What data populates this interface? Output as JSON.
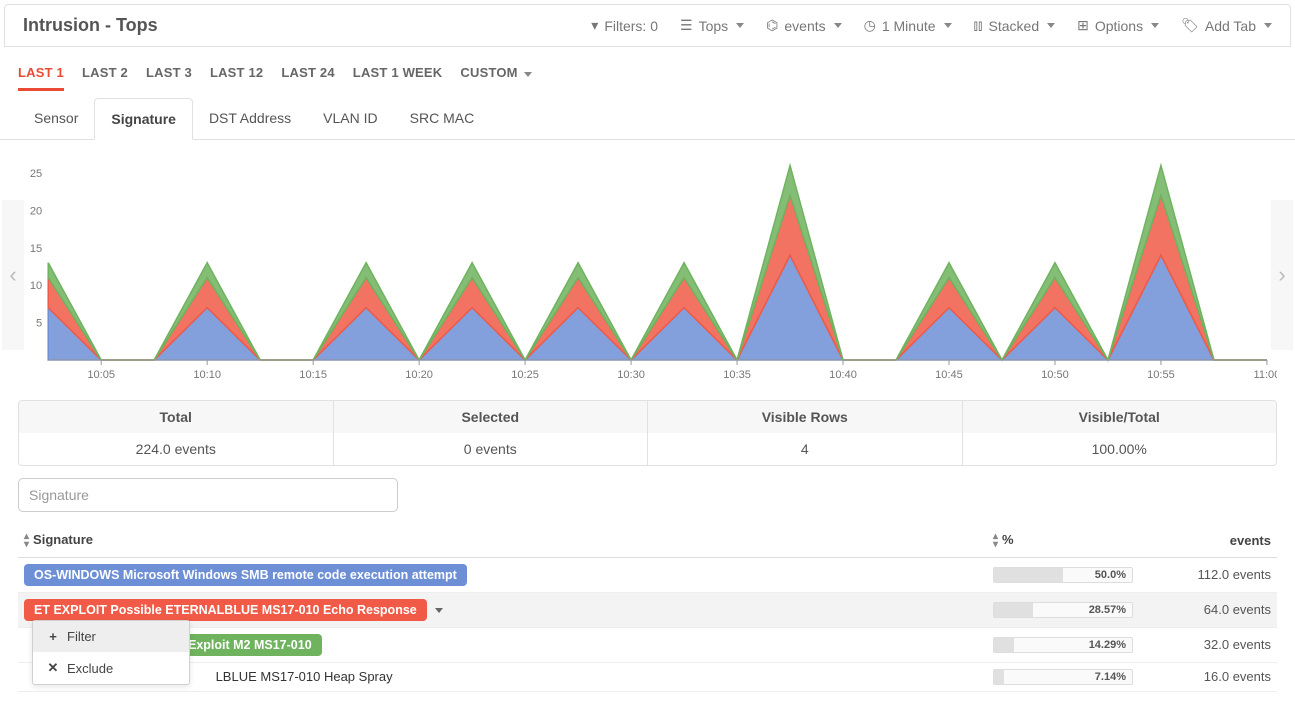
{
  "header": {
    "title": "Intrusion - Tops",
    "filters_label": "Filters: 0",
    "tops_label": "Tops",
    "events_label": "events",
    "interval_label": "1 Minute",
    "stacked_label": "Stacked",
    "options_label": "Options",
    "addtab_label": "Add Tab"
  },
  "time_tabs": [
    "LAST 1",
    "LAST 2",
    "LAST 3",
    "LAST 12",
    "LAST 24",
    "LAST 1 WEEK",
    "CUSTOM"
  ],
  "time_tabs_active": 0,
  "group_tabs": [
    "Sensor",
    "Signature",
    "DST Address",
    "VLAN ID",
    "SRC MAC"
  ],
  "group_tabs_active": 1,
  "chart_data": {
    "type": "area",
    "ylabel": "",
    "ylim": [
      0,
      27
    ],
    "yticks": [
      5,
      10,
      15,
      20,
      25
    ],
    "categories": [
      "",
      "10:05",
      "",
      "10:10",
      "",
      "10:15",
      "",
      "10:20",
      "",
      "10:25",
      "",
      "10:30",
      "",
      "10:35",
      "",
      "10:40",
      "",
      "10:45",
      "",
      "10:50",
      "",
      "10:55",
      "",
      "11:00"
    ],
    "series": [
      {
        "name": "OS-WINDOWS SMB remote code execution",
        "color": "#6d8fd6",
        "values": [
          7,
          0,
          0,
          7,
          0,
          0,
          7,
          0,
          7,
          0,
          7,
          0,
          7,
          0,
          14,
          0,
          0,
          7,
          0,
          7,
          0,
          14,
          0,
          0
        ]
      },
      {
        "name": "ET EXPLOIT ETERNALBLUE Echo Response",
        "color": "#f05a46",
        "values": [
          4,
          0,
          0,
          4,
          0,
          0,
          4,
          0,
          4,
          0,
          4,
          0,
          4,
          0,
          8,
          0,
          0,
          4,
          0,
          4,
          0,
          8,
          0,
          0
        ]
      },
      {
        "name": "ET EXPLOIT Exploit M2 MS17-010",
        "color": "#6fb35e",
        "values": [
          2,
          0,
          0,
          2,
          0,
          0,
          2,
          0,
          2,
          0,
          2,
          0,
          2,
          0,
          4,
          0,
          0,
          2,
          0,
          2,
          0,
          4,
          0,
          0
        ]
      }
    ]
  },
  "summary": {
    "total_label": "Total",
    "total_value": "224.0 events",
    "selected_label": "Selected",
    "selected_value": "0 events",
    "visible_rows_label": "Visible Rows",
    "visible_rows_value": "4",
    "visible_total_label": "Visible/Total",
    "visible_total_value": "100.00%"
  },
  "filter_placeholder": "Signature",
  "columns": {
    "signature": "Signature",
    "pct": "%",
    "events": "events"
  },
  "rows": [
    {
      "signature": "OS-WINDOWS Microsoft Windows SMB remote code execution attempt",
      "color": "blue",
      "pct": 50.0,
      "pct_label": "50.0%",
      "events": "112.0 events",
      "highlight": false,
      "caret": false
    },
    {
      "signature": "ET EXPLOIT Possible ETERNALBLUE MS17-010 Echo Response",
      "color": "red",
      "pct": 28.57,
      "pct_label": "28.57%",
      "events": "64.0 events",
      "highlight": true,
      "caret": true
    },
    {
      "signature": "Exploit M2 MS17-010",
      "prefix_hidden": true,
      "color": "green",
      "pct": 14.29,
      "pct_label": "14.29%",
      "events": "32.0 events",
      "highlight": false,
      "caret": false
    },
    {
      "signature": "LBLUE MS17-010 Heap Spray",
      "prefix_char": "E",
      "plain": true,
      "pct": 7.14,
      "pct_label": "7.14%",
      "events": "16.0 events",
      "highlight": false,
      "caret": false
    }
  ],
  "context_menu": {
    "filter_label": "Filter",
    "exclude_label": "Exclude"
  }
}
